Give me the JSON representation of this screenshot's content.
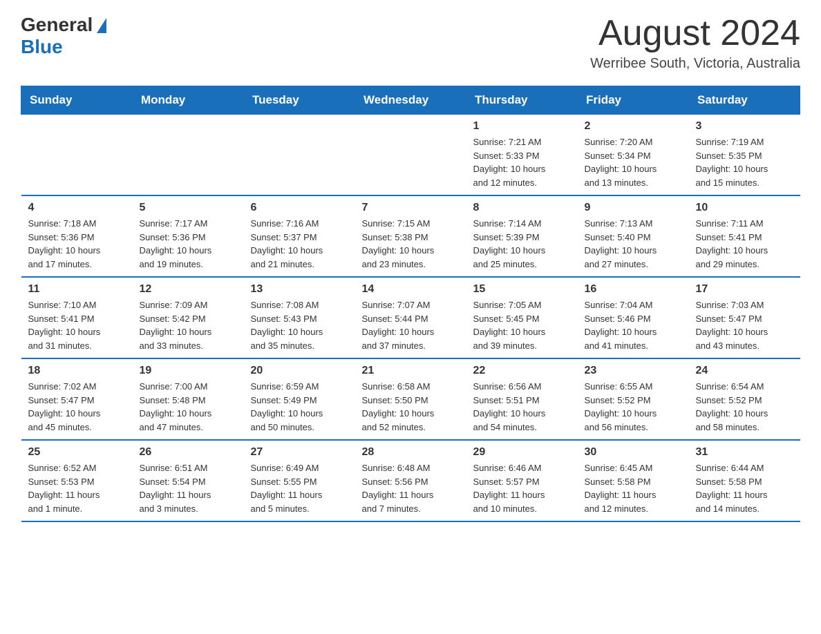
{
  "header": {
    "logo_general": "General",
    "logo_blue": "Blue",
    "month_title": "August 2024",
    "location": "Werribee South, Victoria, Australia"
  },
  "weekdays": [
    "Sunday",
    "Monday",
    "Tuesday",
    "Wednesday",
    "Thursday",
    "Friday",
    "Saturday"
  ],
  "weeks": [
    [
      {
        "day": "",
        "info": ""
      },
      {
        "day": "",
        "info": ""
      },
      {
        "day": "",
        "info": ""
      },
      {
        "day": "",
        "info": ""
      },
      {
        "day": "1",
        "info": "Sunrise: 7:21 AM\nSunset: 5:33 PM\nDaylight: 10 hours\nand 12 minutes."
      },
      {
        "day": "2",
        "info": "Sunrise: 7:20 AM\nSunset: 5:34 PM\nDaylight: 10 hours\nand 13 minutes."
      },
      {
        "day": "3",
        "info": "Sunrise: 7:19 AM\nSunset: 5:35 PM\nDaylight: 10 hours\nand 15 minutes."
      }
    ],
    [
      {
        "day": "4",
        "info": "Sunrise: 7:18 AM\nSunset: 5:36 PM\nDaylight: 10 hours\nand 17 minutes."
      },
      {
        "day": "5",
        "info": "Sunrise: 7:17 AM\nSunset: 5:36 PM\nDaylight: 10 hours\nand 19 minutes."
      },
      {
        "day": "6",
        "info": "Sunrise: 7:16 AM\nSunset: 5:37 PM\nDaylight: 10 hours\nand 21 minutes."
      },
      {
        "day": "7",
        "info": "Sunrise: 7:15 AM\nSunset: 5:38 PM\nDaylight: 10 hours\nand 23 minutes."
      },
      {
        "day": "8",
        "info": "Sunrise: 7:14 AM\nSunset: 5:39 PM\nDaylight: 10 hours\nand 25 minutes."
      },
      {
        "day": "9",
        "info": "Sunrise: 7:13 AM\nSunset: 5:40 PM\nDaylight: 10 hours\nand 27 minutes."
      },
      {
        "day": "10",
        "info": "Sunrise: 7:11 AM\nSunset: 5:41 PM\nDaylight: 10 hours\nand 29 minutes."
      }
    ],
    [
      {
        "day": "11",
        "info": "Sunrise: 7:10 AM\nSunset: 5:41 PM\nDaylight: 10 hours\nand 31 minutes."
      },
      {
        "day": "12",
        "info": "Sunrise: 7:09 AM\nSunset: 5:42 PM\nDaylight: 10 hours\nand 33 minutes."
      },
      {
        "day": "13",
        "info": "Sunrise: 7:08 AM\nSunset: 5:43 PM\nDaylight: 10 hours\nand 35 minutes."
      },
      {
        "day": "14",
        "info": "Sunrise: 7:07 AM\nSunset: 5:44 PM\nDaylight: 10 hours\nand 37 minutes."
      },
      {
        "day": "15",
        "info": "Sunrise: 7:05 AM\nSunset: 5:45 PM\nDaylight: 10 hours\nand 39 minutes."
      },
      {
        "day": "16",
        "info": "Sunrise: 7:04 AM\nSunset: 5:46 PM\nDaylight: 10 hours\nand 41 minutes."
      },
      {
        "day": "17",
        "info": "Sunrise: 7:03 AM\nSunset: 5:47 PM\nDaylight: 10 hours\nand 43 minutes."
      }
    ],
    [
      {
        "day": "18",
        "info": "Sunrise: 7:02 AM\nSunset: 5:47 PM\nDaylight: 10 hours\nand 45 minutes."
      },
      {
        "day": "19",
        "info": "Sunrise: 7:00 AM\nSunset: 5:48 PM\nDaylight: 10 hours\nand 47 minutes."
      },
      {
        "day": "20",
        "info": "Sunrise: 6:59 AM\nSunset: 5:49 PM\nDaylight: 10 hours\nand 50 minutes."
      },
      {
        "day": "21",
        "info": "Sunrise: 6:58 AM\nSunset: 5:50 PM\nDaylight: 10 hours\nand 52 minutes."
      },
      {
        "day": "22",
        "info": "Sunrise: 6:56 AM\nSunset: 5:51 PM\nDaylight: 10 hours\nand 54 minutes."
      },
      {
        "day": "23",
        "info": "Sunrise: 6:55 AM\nSunset: 5:52 PM\nDaylight: 10 hours\nand 56 minutes."
      },
      {
        "day": "24",
        "info": "Sunrise: 6:54 AM\nSunset: 5:52 PM\nDaylight: 10 hours\nand 58 minutes."
      }
    ],
    [
      {
        "day": "25",
        "info": "Sunrise: 6:52 AM\nSunset: 5:53 PM\nDaylight: 11 hours\nand 1 minute."
      },
      {
        "day": "26",
        "info": "Sunrise: 6:51 AM\nSunset: 5:54 PM\nDaylight: 11 hours\nand 3 minutes."
      },
      {
        "day": "27",
        "info": "Sunrise: 6:49 AM\nSunset: 5:55 PM\nDaylight: 11 hours\nand 5 minutes."
      },
      {
        "day": "28",
        "info": "Sunrise: 6:48 AM\nSunset: 5:56 PM\nDaylight: 11 hours\nand 7 minutes."
      },
      {
        "day": "29",
        "info": "Sunrise: 6:46 AM\nSunset: 5:57 PM\nDaylight: 11 hours\nand 10 minutes."
      },
      {
        "day": "30",
        "info": "Sunrise: 6:45 AM\nSunset: 5:58 PM\nDaylight: 11 hours\nand 12 minutes."
      },
      {
        "day": "31",
        "info": "Sunrise: 6:44 AM\nSunset: 5:58 PM\nDaylight: 11 hours\nand 14 minutes."
      }
    ]
  ]
}
